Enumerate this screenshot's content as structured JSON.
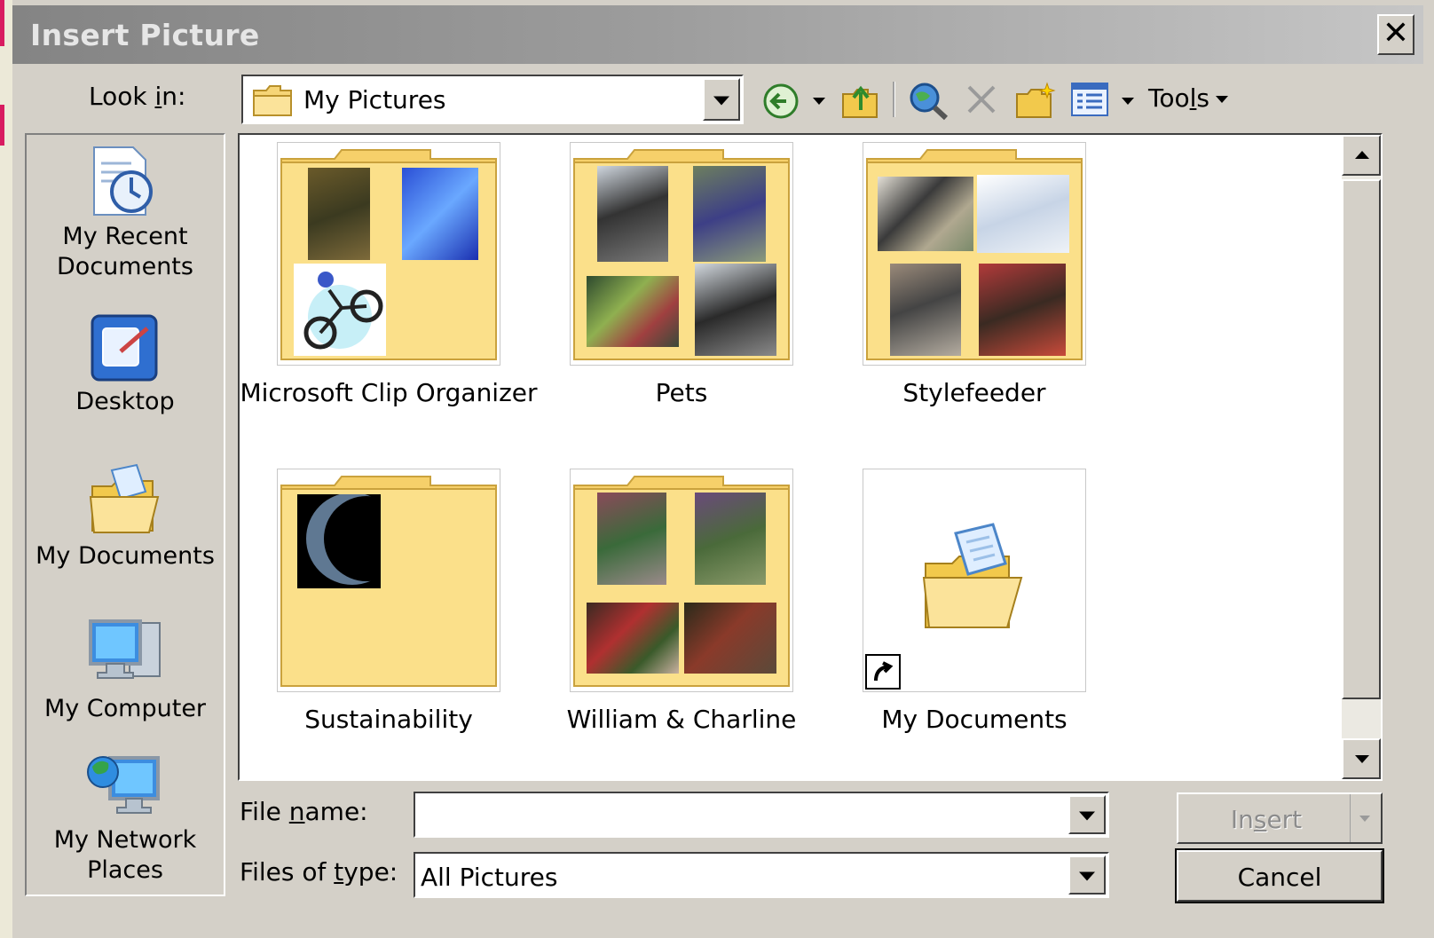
{
  "window": {
    "title": "Insert Picture",
    "close_symbol": "✕"
  },
  "toolbar": {
    "look_in_label": "Look in:",
    "look_in_value": "My Pictures",
    "tools_label": "Tools"
  },
  "places": [
    {
      "label_line1": "My Recent",
      "label_line2": "Documents",
      "icon": "recent-documents-icon"
    },
    {
      "label_line1": "Desktop",
      "label_line2": "",
      "icon": "desktop-icon"
    },
    {
      "label_line1": "My Documents",
      "label_line2": "",
      "icon": "my-documents-icon"
    },
    {
      "label_line1": "My Computer",
      "label_line2": "",
      "icon": "my-computer-icon"
    },
    {
      "label_line1": "My Network",
      "label_line2": "Places",
      "icon": "network-places-icon"
    }
  ],
  "files": [
    {
      "name": "Microsoft Clip Organizer",
      "type": "folder"
    },
    {
      "name": "Pets",
      "type": "folder"
    },
    {
      "name": "Stylefeeder",
      "type": "folder"
    },
    {
      "name": "Sustainability",
      "type": "folder"
    },
    {
      "name": "William & Charline",
      "type": "folder"
    },
    {
      "name": "My Documents",
      "type": "shortcut"
    }
  ],
  "form": {
    "file_name_label": "File name:",
    "file_name_value": "",
    "files_of_type_label": "Files of type:",
    "files_of_type_value": "All Pictures"
  },
  "buttons": {
    "insert": "Insert",
    "cancel": "Cancel"
  },
  "colors": {
    "folder_yellow": "#f9dc7a",
    "title_bar": "#8e8e8e",
    "dialog_face": "#d4d0c8"
  }
}
